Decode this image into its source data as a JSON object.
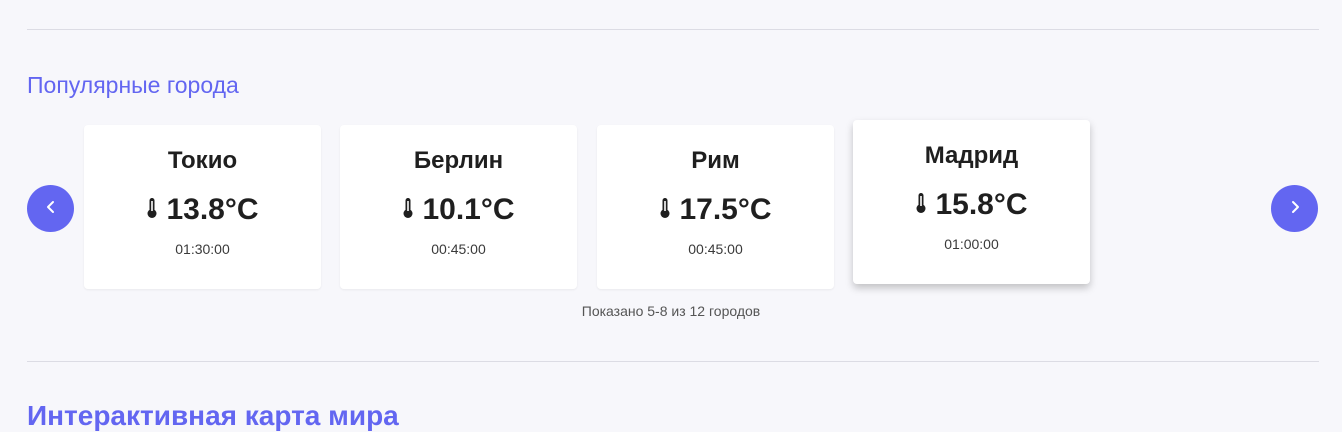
{
  "popular": {
    "title": "Популярные города",
    "cards": [
      {
        "city": "Токио",
        "temp": "13.8°C",
        "time": "01:30:00"
      },
      {
        "city": "Берлин",
        "temp": "10.1°C",
        "time": "00:45:00"
      },
      {
        "city": "Рим",
        "temp": "17.5°C",
        "time": "00:45:00"
      },
      {
        "city": "Мадрид",
        "temp": "15.8°C",
        "time": "01:00:00"
      }
    ],
    "pager": "Показано 5-8 из 12 городов",
    "prev_icon": "chevron-left-icon",
    "next_icon": "chevron-right-icon"
  },
  "next_section": {
    "title": "Интерактивная карта мира"
  },
  "colors": {
    "accent": "#6366f1",
    "background": "#f7f7fb"
  }
}
